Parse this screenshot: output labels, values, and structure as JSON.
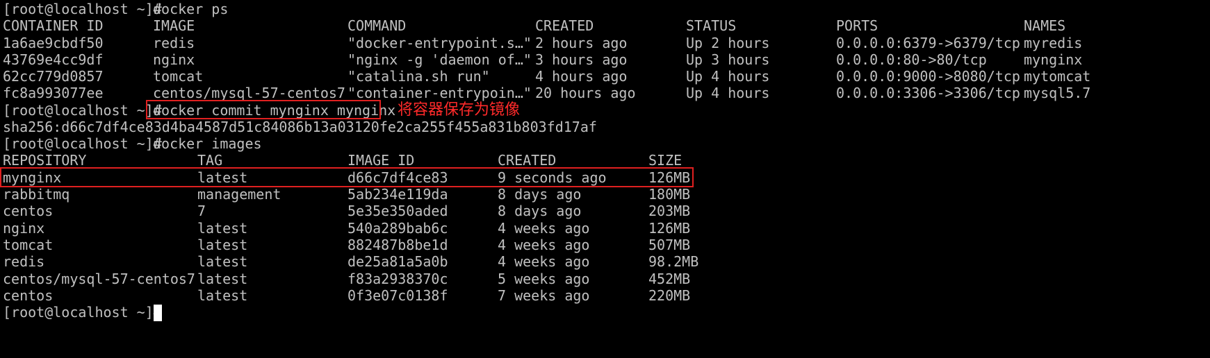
{
  "prompt": "[root@localhost ~]#",
  "lines": {
    "ps_cmd": "docker ps",
    "commit_cmd": "docker commit mynginx mynginx",
    "commit_hash": "sha256:d66c7df4ce83d4ba4587d51c84086b13a03120fe2ca255f455a831b803fd17af",
    "images_cmd": "docker images"
  },
  "ps_table": {
    "headers": [
      "CONTAINER ID",
      "IMAGE",
      "COMMAND",
      "CREATED",
      "STATUS",
      "PORTS",
      "NAMES"
    ],
    "rows": [
      [
        "1a6ae9cbdf50",
        "redis",
        "\"docker-entrypoint.s…\"",
        "2 hours ago",
        "Up 2 hours",
        "0.0.0.0:6379->6379/tcp",
        "myredis"
      ],
      [
        "43769e4cc9df",
        "nginx",
        "\"nginx -g 'daemon of…\"",
        "3 hours ago",
        "Up 3 hours",
        "0.0.0.0:80->80/tcp",
        "mynginx"
      ],
      [
        "62cc779d0857",
        "tomcat",
        "\"catalina.sh run\"",
        "4 hours ago",
        "Up 4 hours",
        "0.0.0.0:9000->8080/tcp",
        "mytomcat"
      ],
      [
        "fc8a993077ee",
        "centos/mysql-57-centos7",
        "\"container-entrypoin…\"",
        "20 hours ago",
        "Up 4 hours",
        "0.0.0.0:3306->3306/tcp",
        "mysql5.7"
      ]
    ]
  },
  "images_table": {
    "headers": [
      "REPOSITORY",
      "TAG",
      "IMAGE ID",
      "CREATED",
      "SIZE"
    ],
    "rows": [
      [
        "mynginx",
        "latest",
        "d66c7df4ce83",
        "9 seconds ago",
        "126MB"
      ],
      [
        "rabbitmq",
        "management",
        "5ab234e119da",
        "8 days ago",
        "180MB"
      ],
      [
        "centos",
        "7",
        "5e35e350aded",
        "8 days ago",
        "203MB"
      ],
      [
        "nginx",
        "latest",
        "540a289bab6c",
        "4 weeks ago",
        "126MB"
      ],
      [
        "tomcat",
        "latest",
        "882487b8be1d",
        "4 weeks ago",
        "507MB"
      ],
      [
        "redis",
        "latest",
        "de25a81a5a0b",
        "4 weeks ago",
        "98.2MB"
      ],
      [
        "centos/mysql-57-centos7",
        "latest",
        "f83a2938370c",
        "5 weeks ago",
        "452MB"
      ],
      [
        "centos",
        "latest",
        "0f3e07c0138f",
        "7 weeks ago",
        "220MB"
      ]
    ]
  },
  "annotation": "将容器保存为镜像",
  "colors": {
    "background": "#000000",
    "text": "#c0c0c0",
    "highlight": "#e02020",
    "annotation": "#ff2a2a",
    "cursor": "#ffffff"
  }
}
